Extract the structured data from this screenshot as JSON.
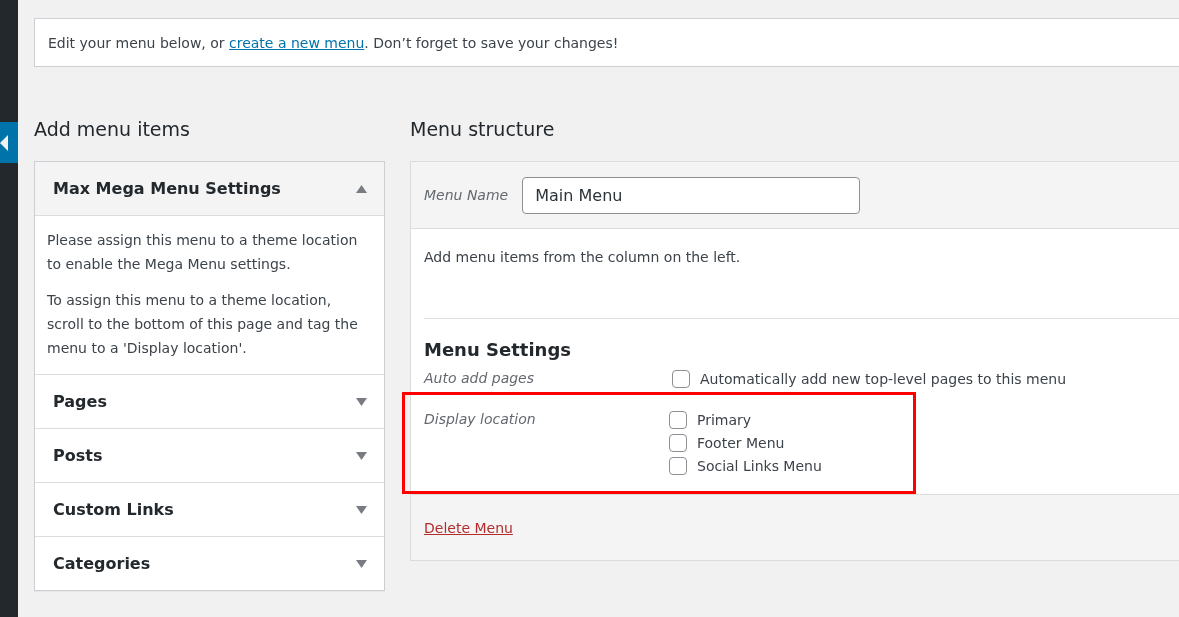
{
  "notice": {
    "before": "Edit your menu below, or ",
    "link": "create a new menu",
    "after": ". Don’t forget to save your changes!"
  },
  "add_items": {
    "title": "Add menu items",
    "sections": [
      {
        "title": "Max Mega Menu Settings",
        "expanded": true,
        "paragraphs": [
          "Please assign this menu to a theme location to enable the Mega Menu settings.",
          "To assign this menu to a theme location, scroll to the bottom of this page and tag the menu to a 'Display location'."
        ]
      },
      {
        "title": "Pages",
        "expanded": false
      },
      {
        "title": "Posts",
        "expanded": false
      },
      {
        "title": "Custom Links",
        "expanded": false
      },
      {
        "title": "Categories",
        "expanded": false
      }
    ]
  },
  "structure": {
    "title": "Menu structure",
    "menu_name_label": "Menu Name",
    "menu_name_value": "Main Menu",
    "hint": "Add menu items from the column on the left.",
    "settings_title": "Menu Settings",
    "settings": [
      {
        "label": "Auto add pages",
        "highlighted": false,
        "options": [
          {
            "label": "Automatically add new top-level pages to this menu",
            "checked": false
          }
        ]
      },
      {
        "label": "Display location",
        "highlighted": true,
        "options": [
          {
            "label": "Primary",
            "checked": false
          },
          {
            "label": "Footer Menu",
            "checked": false
          },
          {
            "label": "Social Links Menu",
            "checked": false
          }
        ]
      }
    ],
    "delete_link": "Delete Menu"
  }
}
